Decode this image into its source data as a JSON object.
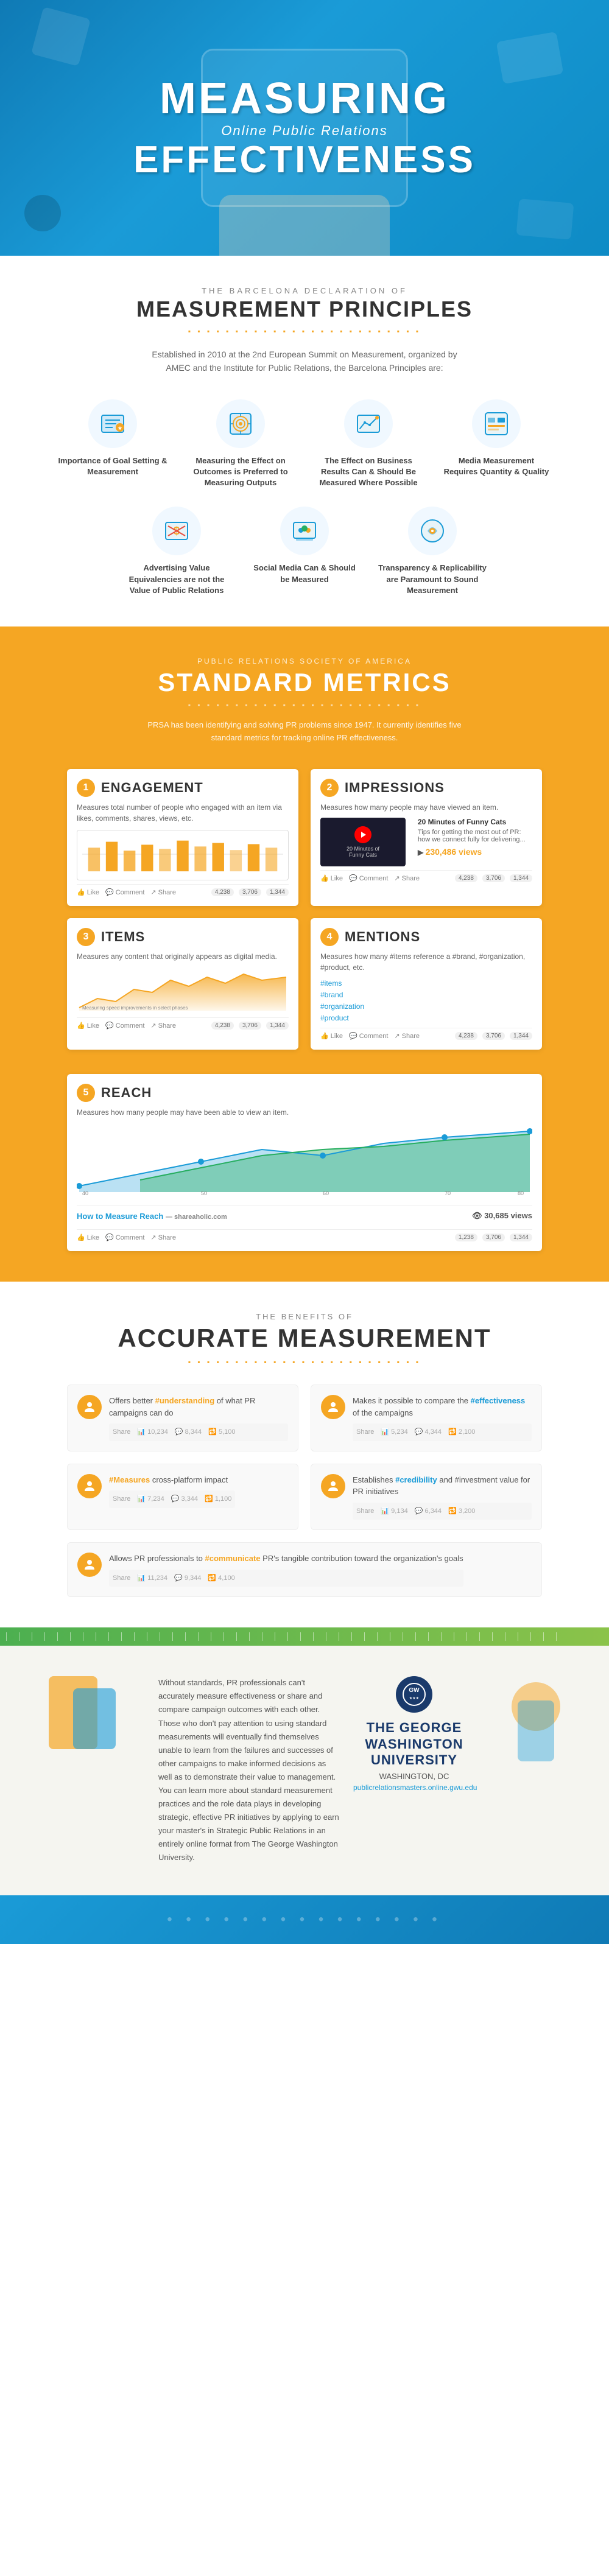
{
  "hero": {
    "line1": "MEASURING",
    "subtitle": "Online Public Relations",
    "line2": "EFFECTIVENESS"
  },
  "barcelona": {
    "eyebrow": "THE BARCELONA DECLARATION OF",
    "title": "MEASUREMENT PRINCIPLES",
    "divider": "▪ ▪ ▪ ▪ ▪ ▪ ▪ ▪ ▪ ▪ ▪ ▪ ▪ ▪ ▪ ▪ ▪ ▪ ▪ ▪ ▪ ▪ ▪ ▪ ▪",
    "description": "Established in 2010 at the 2nd European Summit on Measurement, organized by AMEC and the Institute for Public Relations, the Barcelona Principles are:",
    "principles": [
      {
        "id": "p1",
        "label": "Importance of Goal Setting & Measurement",
        "icon": "goal"
      },
      {
        "id": "p2",
        "label": "Measuring the Effect on Outcomes is Preferred to Measuring Outputs",
        "icon": "outcomes"
      },
      {
        "id": "p3",
        "label": "The Effect on Business Results Can & Should Be Measured Where Possible",
        "icon": "results"
      },
      {
        "id": "p4",
        "label": "Media Measurement Requires Quantity & Quality",
        "icon": "media"
      },
      {
        "id": "p5",
        "label": "Advertising Value Equivalencies are not the Value of Public Relations",
        "icon": "advertising"
      },
      {
        "id": "p6",
        "label": "Social Media Can & Should be Measured",
        "icon": "social"
      },
      {
        "id": "p7",
        "label": "Transparency & Replicability are Paramount to Sound Measurement",
        "icon": "transparency"
      }
    ]
  },
  "metrics": {
    "eyebrow": "PUBLIC RELATIONS SOCIETY OF AMERICA",
    "title": "STANDARD METRICS",
    "divider": "▪ ▪ ▪ ▪ ▪ ▪ ▪ ▪ ▪ ▪ ▪ ▪ ▪ ▪ ▪ ▪ ▪ ▪ ▪ ▪ ▪ ▪ ▪ ▪ ▪",
    "description": "PRSA has been identifying and solving PR problems since 1947. It currently identifies five standard metrics for tracking online PR effectiveness.",
    "items": [
      {
        "number": "1",
        "name": "ENGAGEMENT",
        "description": "Measures total number of people who engaged with an item via likes, comments, shares, views, etc.",
        "fb_actions": [
          "Like",
          "Comment",
          "Share"
        ],
        "counts": [
          "4,238",
          "3,706",
          "1,344"
        ]
      },
      {
        "number": "2",
        "name": "IMPRESSIONS",
        "description": "Measures how many people may have viewed an item.",
        "video_title": "20 Minutes of Funny Cats",
        "video_views": "230,486 views",
        "fb_actions": [
          "Like",
          "Comment",
          "Share"
        ],
        "counts": [
          "4,238",
          "3,706",
          "1,344"
        ]
      },
      {
        "number": "3",
        "name": "ITEMS",
        "description": "Measures any content that originally appears as digital media.",
        "fb_actions": [
          "Like",
          "Comment",
          "Share"
        ],
        "counts": [
          "4,238",
          "3,706",
          "1,344"
        ]
      },
      {
        "number": "4",
        "name": "MENTIONS",
        "description": "Measures how many #items reference a #brand, #organization, #product, etc.",
        "hashtags": [
          "#items",
          "#brand",
          "#organization",
          "#product"
        ],
        "fb_actions": [
          "Like",
          "Comment",
          "Share"
        ],
        "counts": [
          "4,238",
          "3,706",
          "1,344"
        ]
      }
    ],
    "reach": {
      "number": "5",
      "name": "REACH",
      "description": "Measures how many people may have been able to view an item.",
      "link_title": "How to Measure Reach",
      "link_url": "shareaholic.com",
      "views": "30,685 views",
      "fb_actions": [
        "Like",
        "Comment",
        "Share"
      ],
      "counts": [
        "1,238",
        "3,706",
        "1,344"
      ]
    }
  },
  "benefits": {
    "eyebrow": "THE BENEFITS OF",
    "title": "ACCURATE MEASUREMENT",
    "divider": "▪ ▪ ▪ ▪ ▪ ▪ ▪ ▪ ▪ ▪ ▪ ▪ ▪ ▪ ▪ ▪ ▪ ▪ ▪ ▪ ▪ ▪ ▪ ▪ ▪",
    "items": [
      {
        "id": "b1",
        "text_before": "Offers better ",
        "highlight": "#understanding",
        "text_after": " of what PR campaigns can do",
        "icon": "person"
      },
      {
        "id": "b2",
        "text_before": "Makes it possible to compare the ",
        "highlight": "#effectiveness",
        "text_after": " of the campaigns",
        "icon": "person"
      },
      {
        "id": "b3",
        "text_before": "",
        "highlight": "#Measures",
        "text_after": " cross-platform impact",
        "icon": "person"
      },
      {
        "id": "b4",
        "text_before": "Establishes ",
        "highlight": "#credibility",
        "text_after": " and #investment value for PR initiatives",
        "icon": "person"
      },
      {
        "id": "b5",
        "text_before": "Allows PR professionals to ",
        "highlight": "#communicate",
        "text_after": " PR's tangible contribution toward the organization's goals",
        "icon": "person"
      }
    ]
  },
  "footer": {
    "body_text": "Without standards, PR professionals can't accurately measure effectiveness or share and compare campaign outcomes with each other. Those who don't pay attention to using standard measurements will eventually find themselves unable to learn from the failures and successes of other campaigns to make informed decisions as well as to demonstrate their value to management. You can learn more about standard measurement practices and the role data plays in developing strategic, effective PR initiatives by applying to earn your master's in Strategic Public Relations in an entirely online format from The George Washington University.",
    "logo_line1": "THE GEORGE",
    "logo_line2": "WASHINGTON",
    "logo_line3": "UNIVERSITY",
    "location": "WASHINGTON, DC",
    "url": "publicrelationsmasters.online.gwu.edu"
  }
}
